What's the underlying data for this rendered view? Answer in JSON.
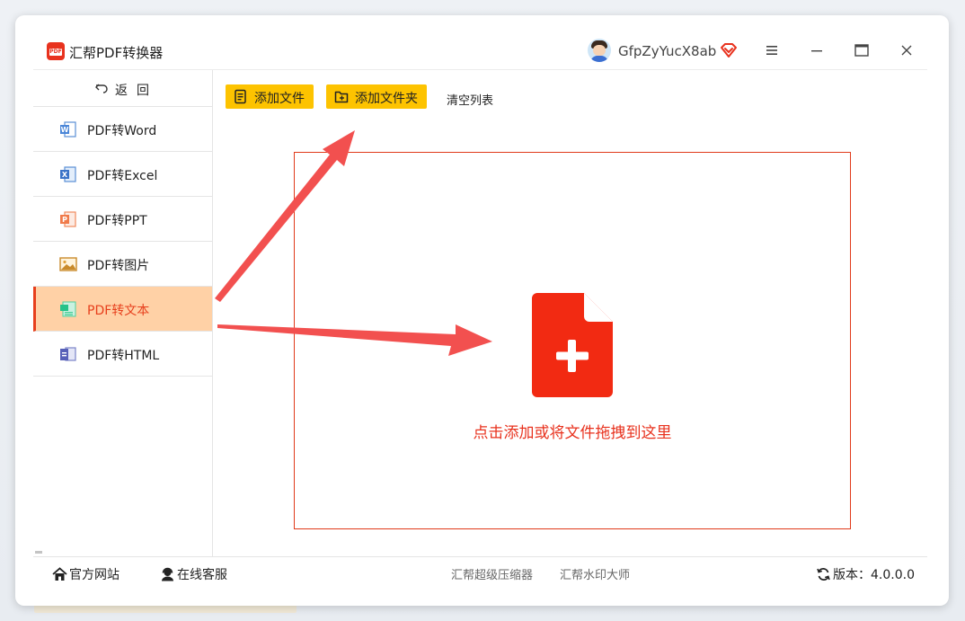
{
  "app": {
    "title": "汇帮PDF转换器",
    "logo_text": "PDF",
    "username": "GfpZyYucX8ab"
  },
  "sidebar": {
    "back_label": "返回",
    "items": [
      {
        "label": "PDF转Word",
        "icon": "word-icon"
      },
      {
        "label": "PDF转Excel",
        "icon": "excel-icon"
      },
      {
        "label": "PDF转PPT",
        "icon": "ppt-icon"
      },
      {
        "label": "PDF转图片",
        "icon": "image-icon"
      },
      {
        "label": "PDF转文本",
        "icon": "text-icon",
        "active": true
      },
      {
        "label": "PDF转HTML",
        "icon": "html-icon"
      }
    ]
  },
  "toolbar": {
    "add_file": "添加文件",
    "add_folder": "添加文件夹",
    "clear_list": "清空列表"
  },
  "dropzone": {
    "hint": "点击添加或将文件拖拽到这里"
  },
  "footer": {
    "official_site": "官方网站",
    "online_service": "在线客服",
    "compressor": "汇帮超级压缩器",
    "watermark": "汇帮水印大师",
    "version": "版本：4.0.0.0"
  },
  "colors": {
    "accent_red": "#e8321e",
    "button_yellow": "#fdc300",
    "active_bg": "#ffd1a6",
    "arrow_red": "#f2504f"
  }
}
